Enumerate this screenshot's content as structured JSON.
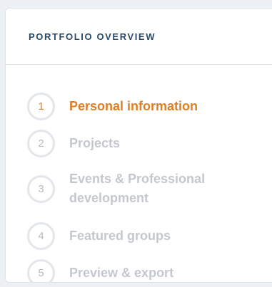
{
  "panel": {
    "title": "PORTFOLIO OVERVIEW"
  },
  "steps": [
    {
      "number": "1",
      "label": "Personal information",
      "active": true
    },
    {
      "number": "2",
      "label": "Projects",
      "active": false
    },
    {
      "number": "3",
      "label_line1": "Events & Professional",
      "label_line2": "development",
      "active": false
    },
    {
      "number": "4",
      "label": "Featured groups",
      "active": false
    },
    {
      "number": "5",
      "label": "Preview & export",
      "active": false
    }
  ],
  "colors": {
    "active": "#e07e22",
    "inactive_text": "#c4c8ce",
    "title": "#2a4a6b"
  }
}
